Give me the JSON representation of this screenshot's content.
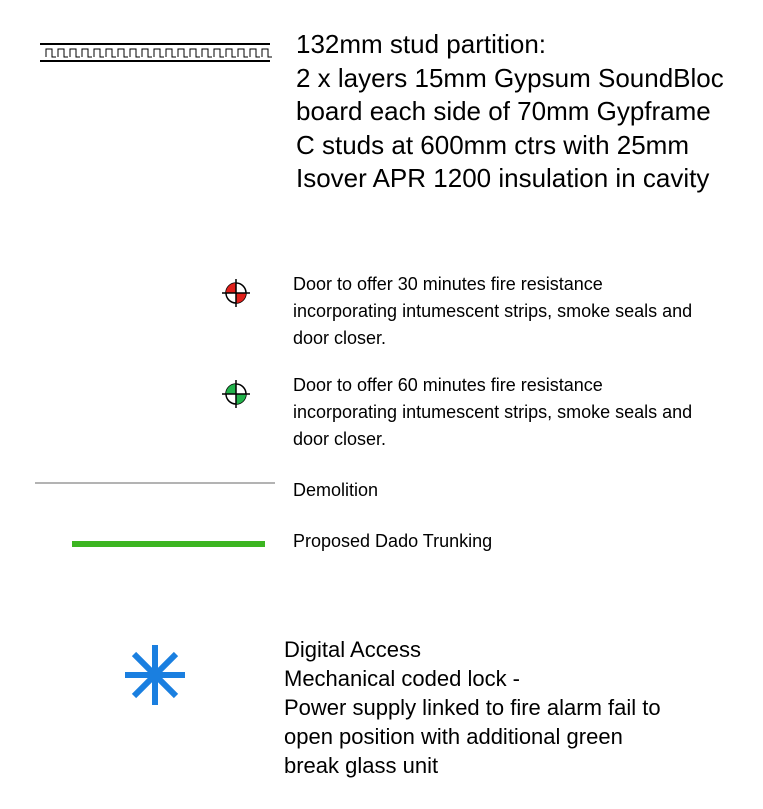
{
  "partition": {
    "lines": [
      "132mm stud partition:",
      "2 x layers 15mm Gypsum SoundBloc",
      "board each side of 70mm Gypframe",
      "C studs at 600mm ctrs with 25mm",
      "Isover APR 1200 insulation in cavity"
    ]
  },
  "door30": {
    "lines": [
      "Door to offer 30 minutes fire resistance",
      "incorporating intumescent strips, smoke seals and",
      "door closer."
    ],
    "color": "#e0201b"
  },
  "door60": {
    "lines": [
      "Door to offer 60 minutes fire resistance",
      "incorporating intumescent strips, smoke seals and",
      "door closer."
    ],
    "color": "#21b24a"
  },
  "demolition": {
    "label": "Demolition",
    "color": "#b3b3b3"
  },
  "dado": {
    "label": "Proposed Dado Trunking",
    "color": "#3cb521"
  },
  "digital_access": {
    "lines": [
      "Digital Access",
      "Mechanical coded lock -",
      "Power supply linked to fire alarm fail to",
      "open position with additional green",
      "break glass unit"
    ],
    "color": "#1a7fe0",
    "icon": "asterisk-icon"
  }
}
